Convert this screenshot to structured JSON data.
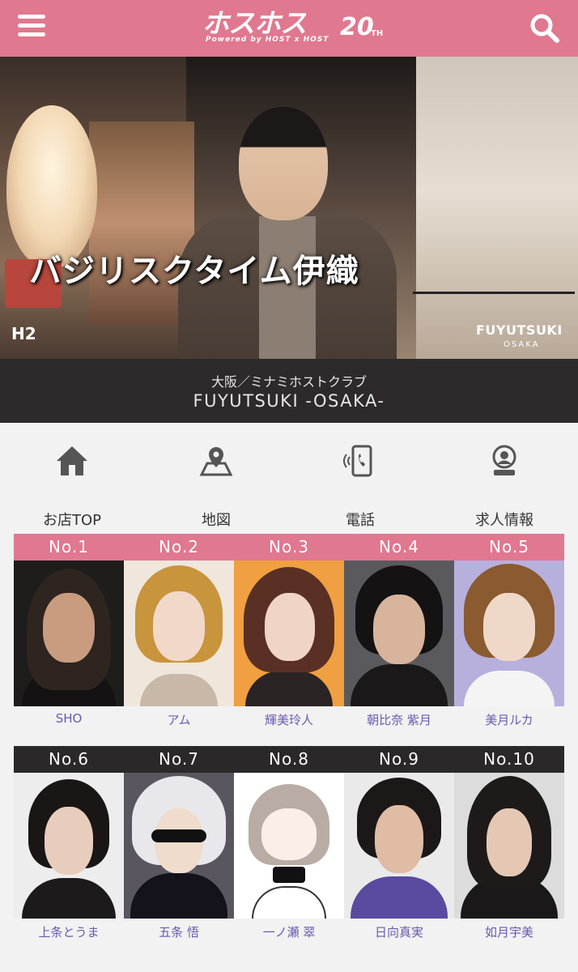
{
  "header": {
    "logo_text": "ホスホス",
    "logo_sub": "Powered by HOST x HOST",
    "logo_anniv": "20",
    "logo_anniv_suffix": "TH",
    "menu_icon": "hamburger-menu-icon",
    "search_icon": "search-icon",
    "accent_color": "#e0788f"
  },
  "hero": {
    "title": "バジリスクタイム伊織",
    "corner_mark": "H2",
    "brand": "FUYUTSUKI",
    "brand_sub": "OSAKA"
  },
  "shop": {
    "area": "大阪／ミナミホストクラブ",
    "name": "FUYUTSUKI -OSAKA-"
  },
  "nav": {
    "items": [
      {
        "label": "お店TOP",
        "icon": "home-icon"
      },
      {
        "label": "地図",
        "icon": "map-pin-icon"
      },
      {
        "label": "電話",
        "icon": "phone-icon"
      },
      {
        "label": "求人情報",
        "icon": "recruit-icon"
      }
    ]
  },
  "ranking": {
    "top": [
      {
        "no": "No.1",
        "name": "SHO"
      },
      {
        "no": "No.2",
        "name": "アム"
      },
      {
        "no": "No.3",
        "name": "輝美玲人"
      },
      {
        "no": "No.4",
        "name": "朝比奈 紫月"
      },
      {
        "no": "No.5",
        "name": "美月ルカ"
      }
    ],
    "bottom": [
      {
        "no": "No.6",
        "name": "上条とうま"
      },
      {
        "no": "No.7",
        "name": "五条 悟"
      },
      {
        "no": "No.8",
        "name": "一ノ瀬 翠"
      },
      {
        "no": "No.9",
        "name": "日向真実"
      },
      {
        "no": "No.10",
        "name": "如月宇美"
      }
    ],
    "top_color": "#e0788f",
    "bottom_color": "#2b2829",
    "name_color": "#6a5ab0"
  }
}
